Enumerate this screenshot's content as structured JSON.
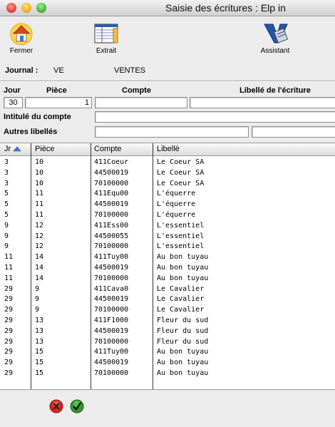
{
  "window": {
    "title": "Saisie des écritures : Elp in"
  },
  "toolbar": {
    "fermer_label": "Fermer",
    "extrait_label": "Extrait",
    "assistant_label": "Assistant"
  },
  "journal": {
    "label": "Journal :",
    "code": "VE",
    "name": "VENTES"
  },
  "entry": {
    "jour_header": "Jour",
    "piece_header": "Pièce",
    "compte_header": "Compte",
    "libelle_header": "Libellé de l'écriture",
    "jour_value": "30",
    "piece_value": "1",
    "compte_value": "",
    "libelle_value": "",
    "intitule_label": "Intitulé du compte",
    "autres_label": "Autres libellés"
  },
  "list": {
    "columns": [
      "Jr",
      "Pièce",
      "Compte",
      "Libellé"
    ],
    "rows": [
      [
        "3",
        "10",
        "411Coeur",
        "Le Coeur SA"
      ],
      [
        "3",
        "10",
        "44500019",
        "Le Coeur SA"
      ],
      [
        "3",
        "10",
        "70100000",
        "Le Coeur SA"
      ],
      [
        "5",
        "11",
        "411Equ00",
        "L'équerre"
      ],
      [
        "5",
        "11",
        "44500019",
        "L'équerre"
      ],
      [
        "5",
        "11",
        "70100000",
        "L'équerre"
      ],
      [
        "9",
        "12",
        "411Ess00",
        "L'essentiel"
      ],
      [
        "9",
        "12",
        "44500055",
        "L'essentiel"
      ],
      [
        "9",
        "12",
        "70100000",
        "L'essentiel"
      ],
      [
        "11",
        "14",
        "411Tuy00",
        "Au bon tuyau"
      ],
      [
        "11",
        "14",
        "44500019",
        "Au bon tuyau"
      ],
      [
        "11",
        "14",
        "70100000",
        "Au bon tuyau"
      ],
      [
        "29",
        "9",
        "411Cava0",
        "Le Cavalier"
      ],
      [
        "29",
        "9",
        "44500019",
        "Le Cavalier"
      ],
      [
        "29",
        "9",
        "70100000",
        "Le Cavalier"
      ],
      [
        "29",
        "13",
        "411F1000",
        "Fleur du sud"
      ],
      [
        "29",
        "13",
        "44500019",
        "Fleur du sud"
      ],
      [
        "29",
        "13",
        "70100000",
        "Fleur du sud"
      ],
      [
        "29",
        "15",
        "411Tuy00",
        "Au bon tuyau"
      ],
      [
        "29",
        "15",
        "44500019",
        "Au bon tuyau"
      ],
      [
        "29",
        "15",
        "70100000",
        "Au bon tuyau"
      ]
    ]
  },
  "icons": {
    "fermer": "house-icon",
    "extrait": "ledger-icon",
    "assistant": "wizard-icon",
    "cancel": "cancel-icon",
    "validate": "checkmark-icon"
  },
  "colors": {
    "cancel": "#d9241b",
    "validate": "#2f9a2a",
    "sort_arrow": "#3d7fd8"
  }
}
